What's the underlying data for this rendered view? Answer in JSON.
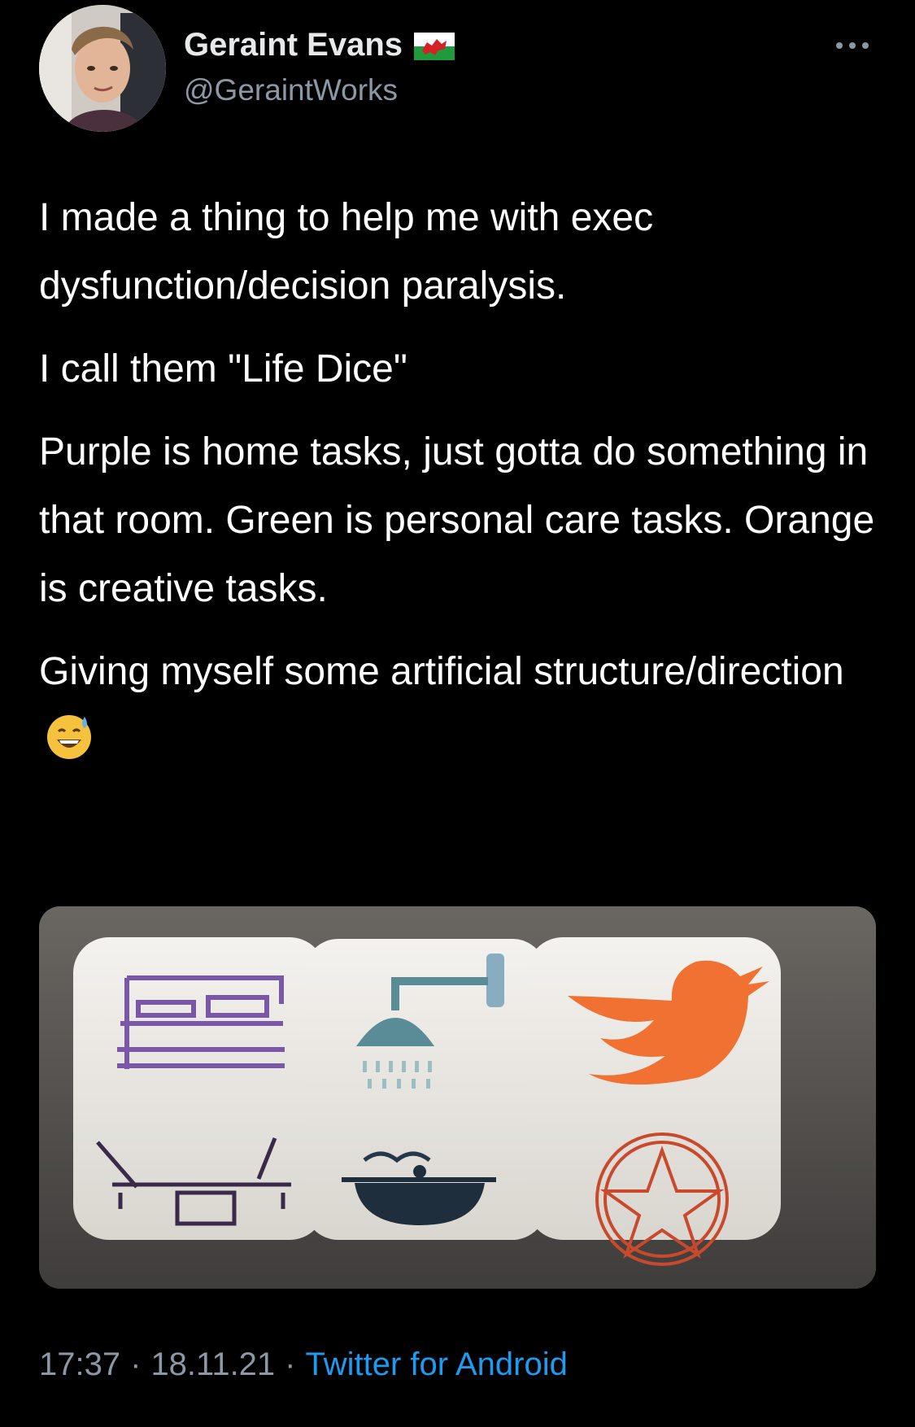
{
  "author": {
    "display_name": "Geraint Evans",
    "handle": "@GeraintWorks",
    "avatar_icon": "profile-photo",
    "badge_icon": "welsh-flag-icon"
  },
  "tweet": {
    "paragraphs": [
      "I made a thing to help me with exec dysfunction/decision paralysis.",
      "I call them \"Life Dice\"",
      "Purple is home tasks, just gotta do something in that room. Green is personal care tasks. Orange is creative tasks.",
      "Giving myself some artificial structure/direction"
    ],
    "trailing_emoji": "grinning-face-with-sweat-icon"
  },
  "media": {
    "icons": [
      "bed-icon",
      "shower-icon",
      "bird-icon",
      "desk-icon",
      "cooking-pot-icon",
      "pentagram-circle-icon"
    ],
    "colors": {
      "purple_die": "#7a57a8",
      "green_die": "#5a8c97",
      "orange_die": "#f07131",
      "die_face": "#efede8"
    }
  },
  "meta": {
    "time": "17:37",
    "date": "18.11.21",
    "separator": "·",
    "source": "Twitter for Android"
  },
  "colors": {
    "background": "#000000",
    "text": "#ffffff",
    "secondary_text": "#8b98a5",
    "link": "#1d9bf0"
  }
}
